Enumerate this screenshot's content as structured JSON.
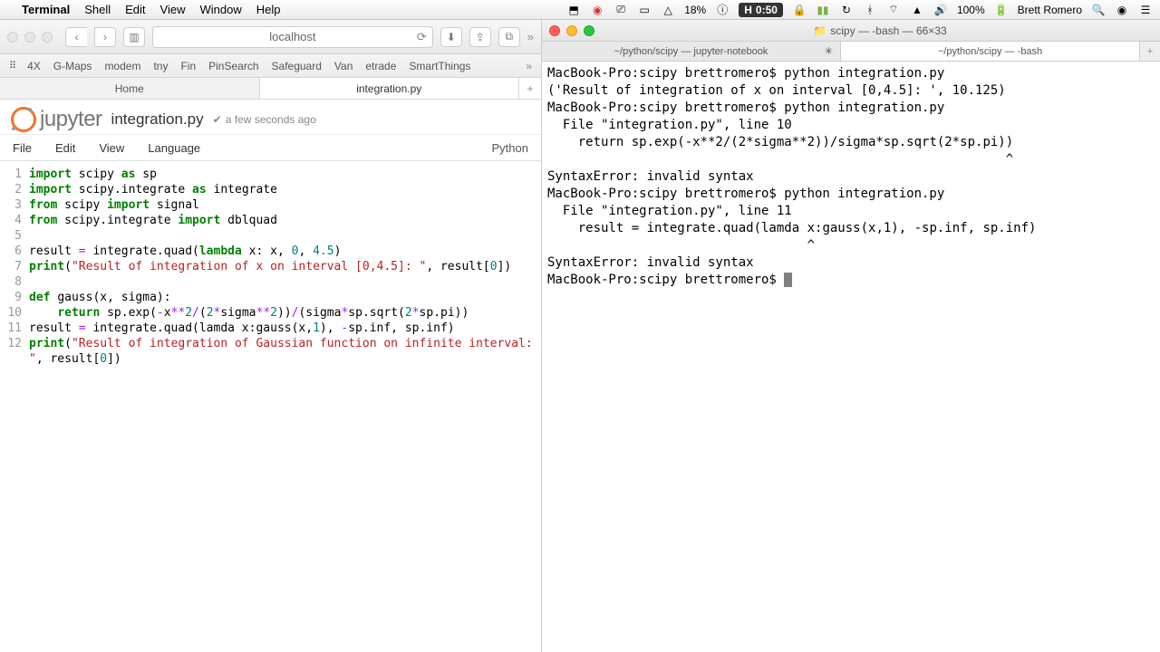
{
  "menubar": {
    "apple": "",
    "app": "Terminal",
    "items": [
      "Shell",
      "Edit",
      "View",
      "Window",
      "Help"
    ],
    "battery": "18%",
    "clock_prefix": "H",
    "clock": "0:50",
    "user": "Brett Romero",
    "wifi": "100%"
  },
  "safari": {
    "address": "localhost",
    "favorites": [
      "4X",
      "G-Maps",
      "modem",
      "tny",
      "Fin",
      "PinSearch",
      "Safeguard",
      "Van",
      "etrade",
      "SmartThings"
    ],
    "tabs": [
      "Home",
      "integration.py"
    ]
  },
  "jupyter": {
    "brand": "jupyter",
    "title": "integration.py",
    "saved": "a few seconds ago",
    "menu": [
      "File",
      "Edit",
      "View",
      "Language"
    ],
    "lang": "Python"
  },
  "code_lines": [
    {
      "n": 1,
      "html": "<span class='kw'>import</span> scipy <span class='kw'>as</span> sp"
    },
    {
      "n": 2,
      "html": "<span class='kw'>import</span> scipy.integrate <span class='kw'>as</span> integrate"
    },
    {
      "n": 3,
      "html": "<span class='kw'>from</span> scipy <span class='kw'>import</span> signal"
    },
    {
      "n": 4,
      "html": "<span class='kw'>from</span> scipy.integrate <span class='kw'>import</span> dblquad"
    },
    {
      "n": 5,
      "html": ""
    },
    {
      "n": 6,
      "html": "result <span class='op'>=</span> integrate.quad(<span class='kw'>lambda</span> x: x, <span class='num'>0</span>, <span class='num'>4.5</span>)"
    },
    {
      "n": 7,
      "html": "<span class='kw'>print</span>(<span class='str'>\"Result of integration of x on interval [0,4.5]: \"</span>, result[<span class='num'>0</span>])"
    },
    {
      "n": 8,
      "html": ""
    },
    {
      "n": 9,
      "html": "<span class='kw'>def</span> <span class='nm'>gauss</span>(x, sigma):"
    },
    {
      "n": 10,
      "html": "    <span class='kw'>return</span> sp.exp(<span class='op'>-</span>x<span class='op'>**</span><span class='num'>2</span><span class='op'>/</span>(<span class='num'>2</span><span class='op'>*</span>sigma<span class='op'>**</span><span class='num'>2</span>))<span class='op'>/</span>(sigma<span class='op'>*</span>sp.sqrt(<span class='num'>2</span><span class='op'>*</span>sp.pi))"
    },
    {
      "n": 11,
      "html": "result <span class='op'>=</span> integrate.quad(lamda x:gauss(x,<span class='num'>1</span>), <span class='op'>-</span>sp.inf, sp.inf)"
    },
    {
      "n": 12,
      "html": "<span class='kw'>print</span>(<span class='str'>\"Result of integration of Gaussian function on infinite interval: \"</span>, result[<span class='num'>0</span>])"
    }
  ],
  "terminal": {
    "title": "scipy — -bash — 66×33",
    "tabs": [
      "~/python/scipy — jupyter-notebook",
      "~/python/scipy — -bash"
    ],
    "lines": [
      "MacBook-Pro:scipy brettromero$ python integration.py",
      "('Result of integration of x on interval [0,4.5]: ', 10.125)",
      "MacBook-Pro:scipy brettromero$ python integration.py",
      "  File \"integration.py\", line 10",
      "    return sp.exp(-x**2/(2*sigma**2))/sigma*sp.sqrt(2*sp.pi))",
      "                                                            ^",
      "SyntaxError: invalid syntax",
      "MacBook-Pro:scipy brettromero$ python integration.py",
      "  File \"integration.py\", line 11",
      "    result = integrate.quad(lamda x:gauss(x,1), -sp.inf, sp.inf)",
      "                                  ^",
      "SyntaxError: invalid syntax",
      "MacBook-Pro:scipy brettromero$ "
    ]
  }
}
